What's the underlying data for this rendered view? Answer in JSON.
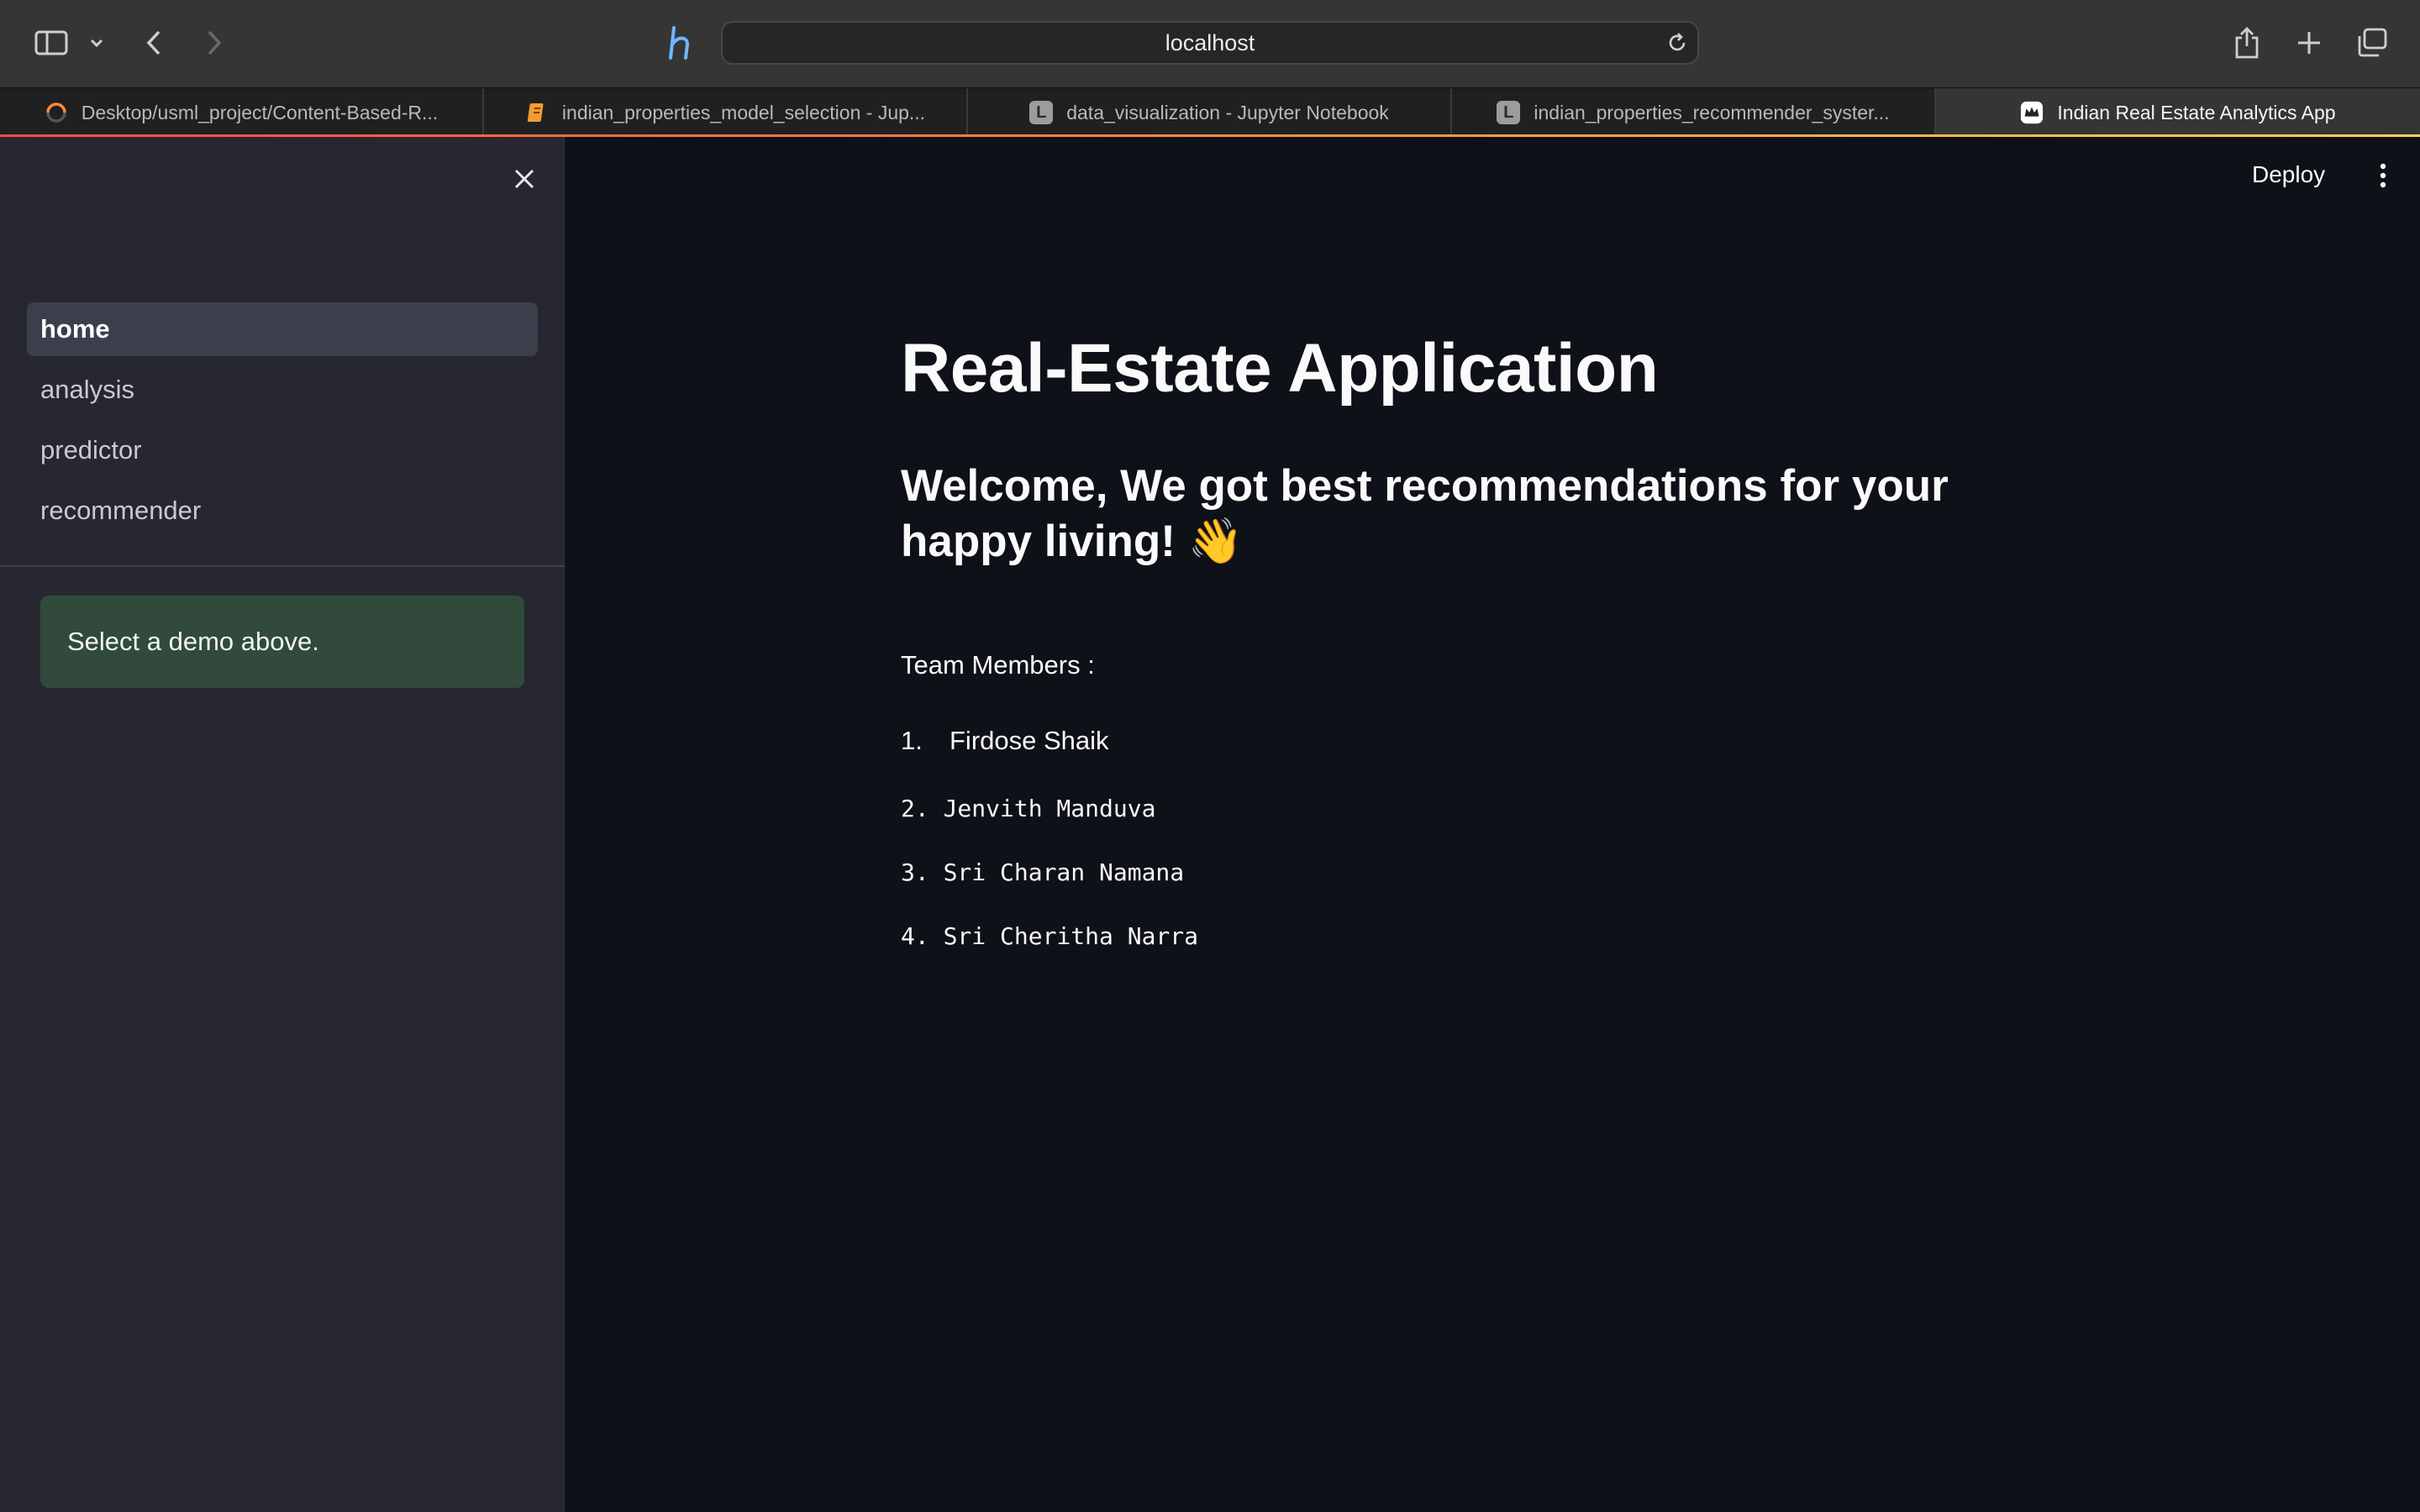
{
  "browser": {
    "url": "localhost",
    "tabs": [
      {
        "label": "Desktop/usml_project/Content-Based-R...",
        "icon": "spinner-icon"
      },
      {
        "label": "indian_properties_model_selection - Jup...",
        "icon": "notebook-icon"
      },
      {
        "label": "data_visualization - Jupyter Notebook",
        "icon": "L"
      },
      {
        "label": "indian_properties_recommender_syster...",
        "icon": "L"
      },
      {
        "label": "Indian Real Estate Analytics App",
        "icon": "streamlit-crown-icon",
        "active": true
      }
    ]
  },
  "sidebar": {
    "nav": [
      {
        "label": "home",
        "active": true
      },
      {
        "label": "analysis"
      },
      {
        "label": "predictor"
      },
      {
        "label": "recommender"
      }
    ],
    "info": "Select a demo above."
  },
  "header": {
    "deploy_label": "Deploy"
  },
  "main": {
    "title": "Real-Estate Application",
    "subtitle": "Welcome, We got best recommendations for your happy living! 👋",
    "team_label": "Team Members :",
    "member1_num": "1.",
    "member1_name": "Firdose Shaik",
    "members_code": [
      "2. Jenvith Manduva",
      "3. Sri Charan Namana",
      "4. Sri Cheritha Narra"
    ]
  },
  "colors": {
    "app_bg": "#0e1117",
    "sidebar_bg": "#262730",
    "info_bg": "#314a3b",
    "accent": "#ff4b4b"
  }
}
